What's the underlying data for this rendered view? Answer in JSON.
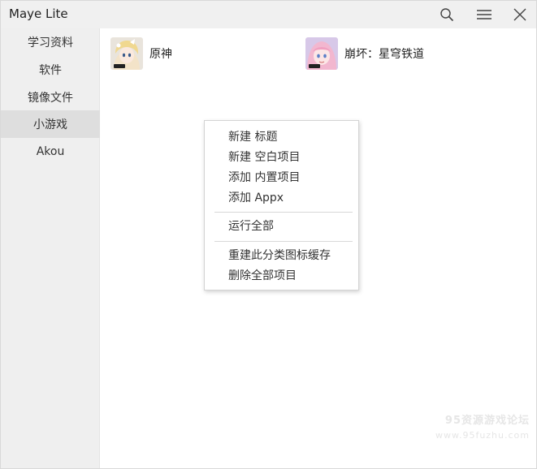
{
  "titlebar": {
    "title": "Maye Lite",
    "icons": [
      "search-icon",
      "menu-icon",
      "close-icon"
    ]
  },
  "sidebar": {
    "items": [
      {
        "label": "学习资料",
        "active": false
      },
      {
        "label": "软件",
        "active": false
      },
      {
        "label": "镜像文件",
        "active": false
      },
      {
        "label": "小游戏",
        "active": true
      },
      {
        "label": "Akou",
        "active": false
      }
    ]
  },
  "content": {
    "apps": [
      {
        "name": "原神",
        "icon": "genshin-app-icon"
      },
      {
        "name": "崩坏：星穹铁道",
        "icon": "starrail-app-icon"
      }
    ]
  },
  "context_menu": {
    "groups": [
      [
        "新建 标题",
        "新建 空白项目",
        "添加 内置项目",
        "添加 Appx"
      ],
      [
        "运行全部"
      ],
      [
        "重建此分类图标缓存",
        "删除全部项目"
      ]
    ]
  },
  "watermark": {
    "line1": "95资源游戏论坛",
    "line2": "www.95fuzhu.com"
  },
  "colors": {
    "sidebar_bg": "#efefef",
    "sidebar_active": "#dedede",
    "titlebar_bg": "#f0f0f0",
    "content_bg": "#ffffff"
  }
}
